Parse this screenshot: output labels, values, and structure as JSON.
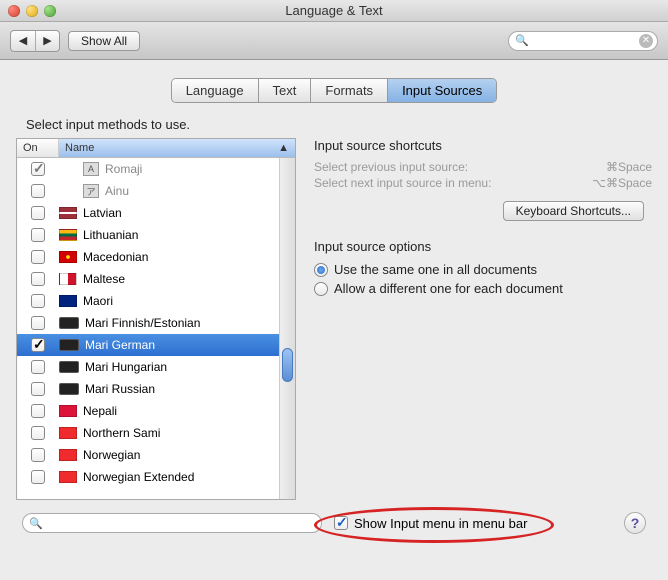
{
  "window": {
    "title": "Language & Text"
  },
  "toolbar": {
    "show_all": "Show All",
    "search_placeholder": ""
  },
  "tabs": {
    "language": "Language",
    "text": "Text",
    "formats": "Formats",
    "input_sources": "Input Sources"
  },
  "subtitle": "Select input methods to use.",
  "columns": {
    "on": "On",
    "name": "Name"
  },
  "list": {
    "items": [
      {
        "name": "Romaji",
        "checked": true,
        "indent": true,
        "icon": "char",
        "char": "A"
      },
      {
        "name": "Ainu",
        "checked": false,
        "indent": true,
        "icon": "char",
        "char": "ア"
      },
      {
        "name": "Latvian",
        "checked": false,
        "flag": "lv"
      },
      {
        "name": "Lithuanian",
        "checked": false,
        "flag": "lt"
      },
      {
        "name": "Macedonian",
        "checked": false,
        "flag": "mk"
      },
      {
        "name": "Maltese",
        "checked": false,
        "flag": "mt"
      },
      {
        "name": "Maori",
        "checked": false,
        "flag": "nz"
      },
      {
        "name": "Mari Finnish/Estonian",
        "checked": false,
        "icon": "kb"
      },
      {
        "name": "Mari German",
        "checked": true,
        "icon": "kb",
        "selected": true
      },
      {
        "name": "Mari Hungarian",
        "checked": false,
        "icon": "kb"
      },
      {
        "name": "Mari Russian",
        "checked": false,
        "icon": "kb"
      },
      {
        "name": "Nepali",
        "checked": false,
        "flag": "np"
      },
      {
        "name": "Northern Sami",
        "checked": false,
        "flag": "no"
      },
      {
        "name": "Norwegian",
        "checked": false,
        "flag": "no"
      },
      {
        "name": "Norwegian Extended",
        "checked": false,
        "flag": "no"
      }
    ]
  },
  "shortcuts": {
    "heading": "Input source shortcuts",
    "prev_label": "Select previous input source:",
    "prev_keys": "⌘Space",
    "next_label": "Select next input source in menu:",
    "next_keys": "⌥⌘Space",
    "button": "Keyboard Shortcuts..."
  },
  "options": {
    "heading": "Input source options",
    "same": "Use the same one in all documents",
    "diff": "Allow a different one for each document"
  },
  "footer": {
    "show_input_menu": "Show Input menu in menu bar"
  },
  "flags": {
    "lv": {
      "bg": "linear-gradient(#9e3039 40%, #fff 40%, #fff 60%, #9e3039 60%)"
    },
    "lt": {
      "bg": "linear-gradient(#fdb913 33%, #006a44 33%, #006a44 66%, #c1272d 66%)"
    },
    "mk": {
      "bg": "radial-gradient(circle at 50% 50%, #ffe600 20%, #d20000 20%)"
    },
    "mt": {
      "bg": "linear-gradient(90deg,#fff 50%,#cf142b 50%)"
    },
    "nz": {
      "bg": "#00247d"
    },
    "np": {
      "bg": "#dc143c"
    },
    "no": {
      "bg": "linear-gradient(#ef2b2d,#ef2b2d)"
    }
  }
}
